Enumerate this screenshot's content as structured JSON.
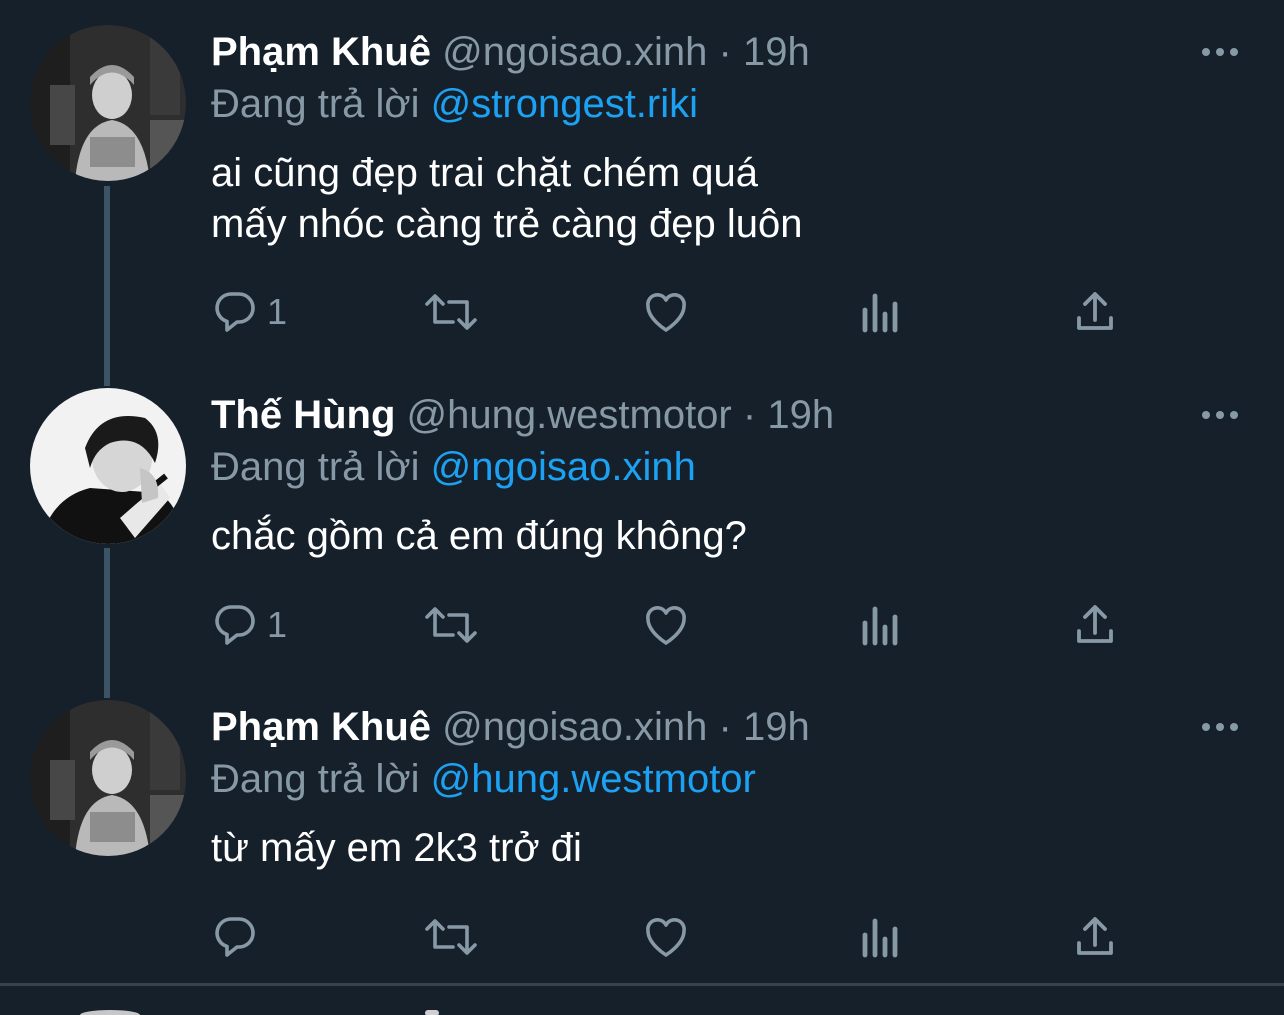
{
  "tweets": [
    {
      "name": "Phạm Khuê",
      "handle": "@ngoisao.xinh",
      "separator": "·",
      "time": "19h",
      "reply_prefix": "Đang trả lời",
      "reply_to": "@strongest.riki",
      "text_lines": [
        "ai cũng đẹp trai chặt chém quá",
        "mấy nhóc càng trẻ càng đẹp luôn"
      ],
      "reply_count": "1",
      "avatar": "avatar-pham-khue"
    },
    {
      "name": "Thế Hùng",
      "handle": "@hung.westmotor",
      "separator": "·",
      "time": "19h",
      "reply_prefix": "Đang trả lời",
      "reply_to": "@ngoisao.xinh",
      "text_lines": [
        "chắc gồm cả em đúng không?"
      ],
      "reply_count": "1",
      "avatar": "avatar-the-hung"
    },
    {
      "name": "Phạm Khuê",
      "handle": "@ngoisao.xinh",
      "separator": "·",
      "time": "19h",
      "reply_prefix": "Đang trả lời",
      "reply_to": "@hung.westmotor",
      "text_lines": [
        "từ mấy em 2k3 trở đi"
      ],
      "reply_count": "",
      "avatar": "avatar-pham-khue"
    }
  ],
  "icons": {
    "reply": "reply-icon",
    "retweet": "retweet-icon",
    "like": "heart-icon",
    "analytics": "analytics-icon",
    "share": "share-icon",
    "more": "more-icon"
  },
  "colors": {
    "background": "#15202b",
    "text": "#ffffff",
    "muted": "#8899a6",
    "link": "#1da1f2",
    "thread_line": "#3d5466"
  }
}
